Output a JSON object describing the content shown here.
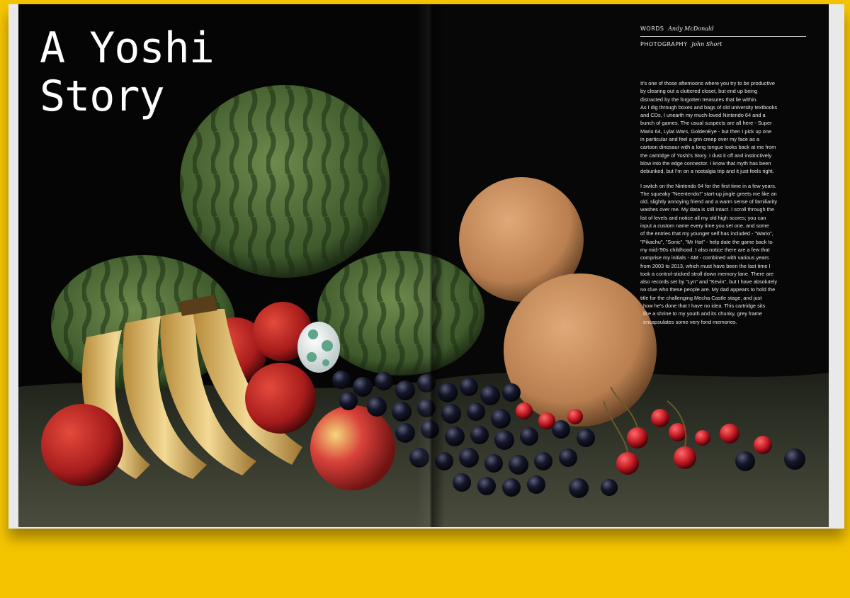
{
  "article": {
    "title_line1": "A Yoshi",
    "title_line2": "Story",
    "credits": [
      {
        "label": "WORDS",
        "name": "Andy McDonald"
      },
      {
        "label": "PHOTOGRAPHY",
        "name": "John Short"
      }
    ],
    "paragraph1": [
      "It's one of those afternoons where you try to be productive",
      "by clearing out a cluttered closet, but end up being",
      "distracted by the forgotten treasures that lie within.",
      "As I dig through boxes and bags of old university textbooks",
      "and CDs, I unearth my much-loved Nintendo 64 and a",
      "bunch of games. The usual suspects are all here - Super",
      "Mario 64, Lylat Wars, GoldenEye - but then I pick up one",
      "in particular and feel a grin creep over my face as a",
      "cartoon dinosaur with a long tongue looks back at me from",
      "the cartridge of Yoshi's Story. I dust it off and instinctively",
      "blow into the edge connector. I know that myth has been",
      "debunked, but I'm on a nostalgia trip and it just feels right."
    ],
    "paragraph2": [
      "I switch on the Nintendo 64 for the first time in a few years.",
      "The squeaky \"Neentendo!\" start-up jingle greets me like an",
      "old, slightly annoying friend and a warm sense of familiarity",
      "washes over me. My data is still intact. I scroll through the",
      "list of levels and notice all my old high scores; you can",
      "input a custom name every time you set one, and some",
      "of the entries that my younger self has included - \"Wario\",",
      "\"Pikachu\", \"Sonic\", \"Mr Hat\" - help date the game back to",
      "my mid-'90s childhood. I also notice there are a few that",
      "comprise my initials - AM - combined with various years",
      "from 2003 to 2013, which must have been the last time I",
      "took a control-sticked stroll down memory lane. There are",
      "also records set by \"Lyn\" and \"Kevin\", but I have absolutely",
      "no clue who these people are. My dad appears to hold the",
      "title for the challenging Mecha Castle stage, and just",
      "how he's done that I have no idea. This cartridge sits",
      "like a shrine to my youth and its chunky, grey frame",
      "encapsulates some very fond memories."
    ]
  },
  "colors": {
    "background": "#f5c400",
    "page": "#050505",
    "text": "#e6e6e6"
  }
}
